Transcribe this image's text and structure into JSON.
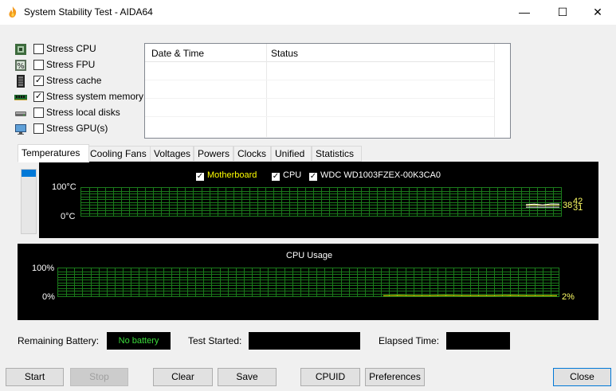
{
  "window": {
    "title": "System Stability Test - AIDA64",
    "controls": {
      "minimize": "—",
      "maximize": "☐",
      "close": "✕"
    }
  },
  "stress_options": [
    {
      "label": "Stress CPU",
      "checked": false,
      "icon": "cpu-chip-icon"
    },
    {
      "label": "Stress FPU",
      "checked": false,
      "icon": "fpu-percent-icon"
    },
    {
      "label": "Stress cache",
      "checked": true,
      "icon": "cache-memory-icon"
    },
    {
      "label": "Stress system memory",
      "checked": true,
      "icon": "ram-module-icon"
    },
    {
      "label": "Stress local disks",
      "checked": false,
      "icon": "hard-disk-icon"
    },
    {
      "label": "Stress GPU(s)",
      "checked": false,
      "icon": "monitor-gpu-icon"
    }
  ],
  "log_table": {
    "columns": [
      "Date & Time",
      "Status"
    ],
    "rows": []
  },
  "tabs": [
    "Temperatures",
    "Cooling Fans",
    "Voltages",
    "Powers",
    "Clocks",
    "Unified",
    "Statistics"
  ],
  "active_tab": "Temperatures",
  "temperature_graph": {
    "legend": [
      {
        "label": "Motherboard",
        "checked": true,
        "color": "#ffff00"
      },
      {
        "label": "CPU",
        "checked": true,
        "color": "#ffffff"
      },
      {
        "label": "WDC WD1003FZEX-00K3CA0",
        "checked": true,
        "color": "#ffffff"
      }
    ],
    "y_max_label": "100°C",
    "y_min_label": "0°C",
    "current_values": [
      "38",
      "42",
      "31"
    ]
  },
  "cpu_usage_graph": {
    "title": "CPU Usage",
    "y_max_label": "100%",
    "y_min_label": "0%",
    "current_value": "2%"
  },
  "chart_data": [
    {
      "type": "line",
      "title": "",
      "ylim": [
        0,
        100
      ],
      "series": [
        {
          "name": "Motherboard",
          "values": [
            38,
            38,
            38,
            38,
            38
          ]
        },
        {
          "name": "CPU",
          "values": [
            40,
            42,
            39,
            43,
            42
          ]
        },
        {
          "name": "WDC WD1003FZEX-00K3CA0",
          "values": [
            31,
            31,
            31,
            31,
            31
          ]
        }
      ]
    },
    {
      "type": "line",
      "title": "CPU Usage",
      "ylim": [
        0,
        100
      ],
      "series": [
        {
          "values": [
            2,
            3,
            2,
            2,
            3,
            2,
            2,
            2,
            3,
            2,
            2,
            2
          ]
        }
      ]
    }
  ],
  "status": {
    "remaining_battery_label": "Remaining Battery:",
    "remaining_battery_value": "No battery",
    "test_started_label": "Test Started:",
    "test_started_value": "",
    "elapsed_time_label": "Elapsed Time:",
    "elapsed_time_value": ""
  },
  "buttons": {
    "start": "Start",
    "stop": "Stop",
    "clear": "Clear",
    "save": "Save",
    "cpuid": "CPUID",
    "preferences": "Preferences",
    "close": "Close"
  },
  "colors": {
    "graph_background": "#000000",
    "grid": "#1b7a1b",
    "temp_line": "#ffffff",
    "usage_line": "#ffff00",
    "battery_text": "#3bdc3b",
    "selection": "#0078d7"
  }
}
